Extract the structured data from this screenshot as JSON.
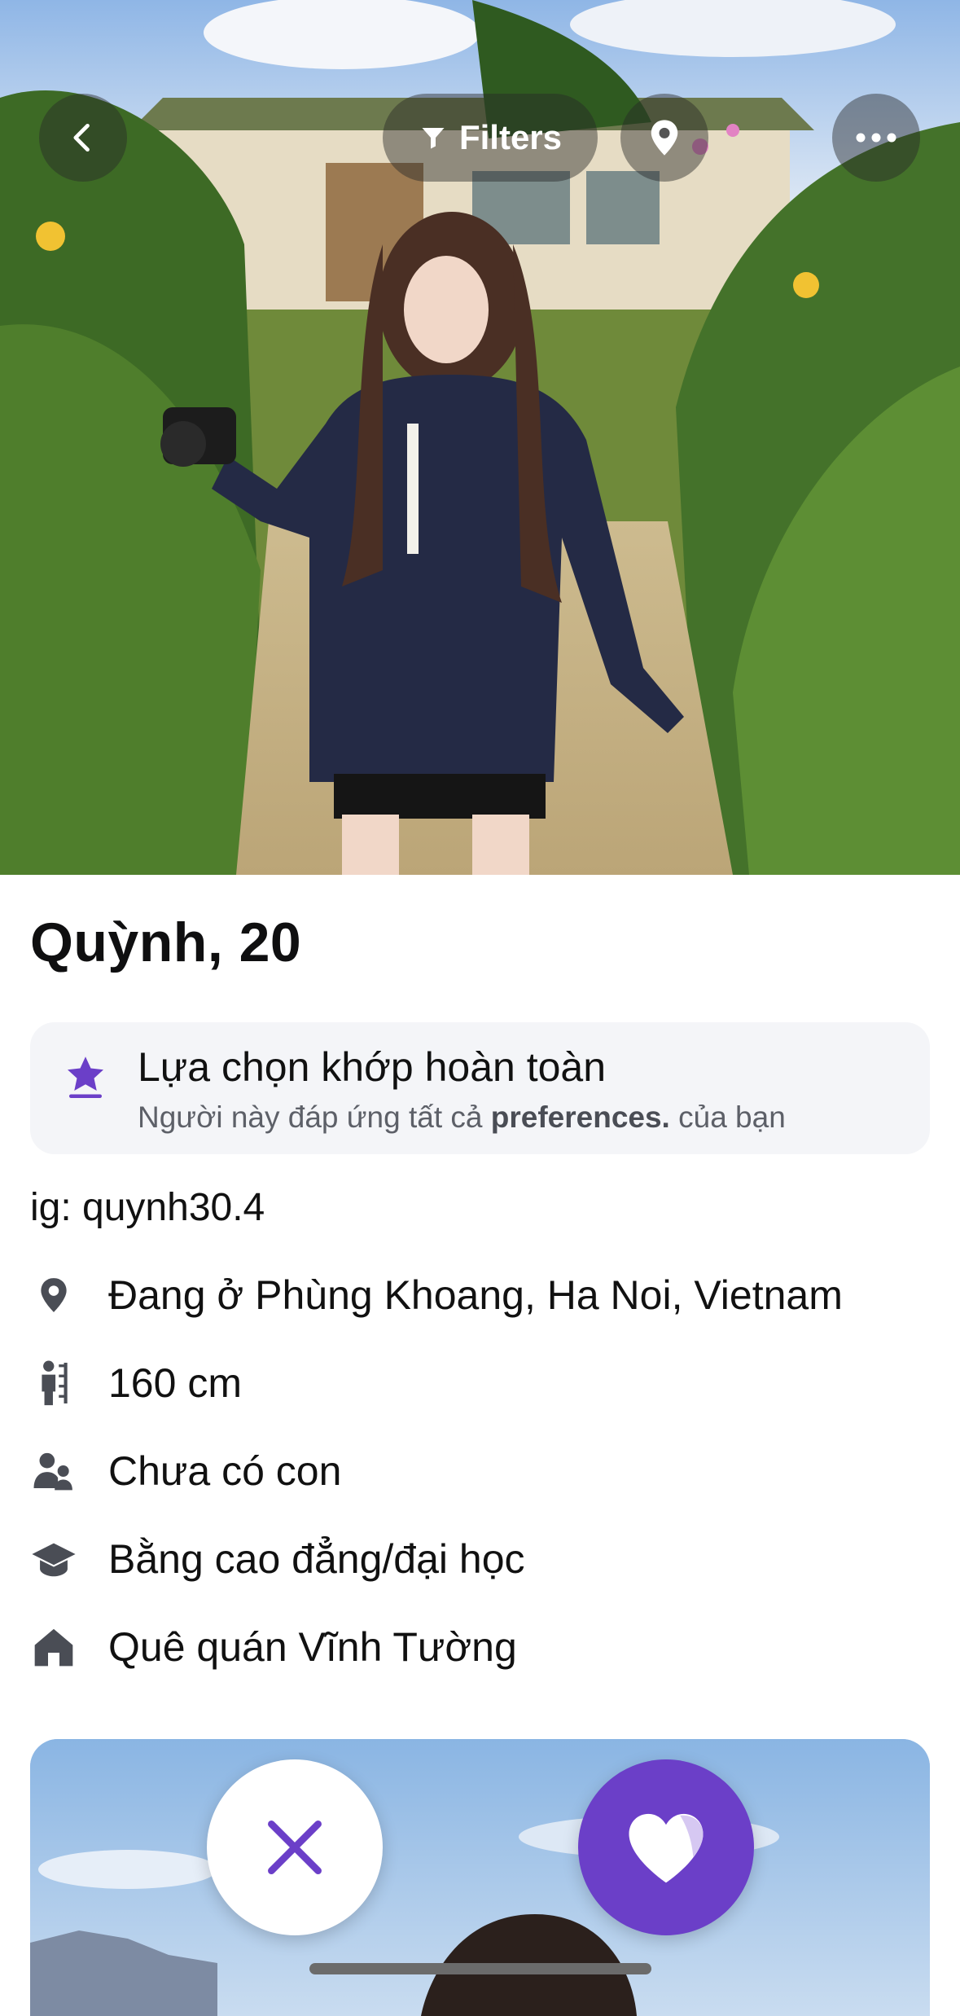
{
  "header": {
    "filters_label": "Filters",
    "icons": [
      "chevron-left-icon",
      "filter-icon",
      "location-pin-icon",
      "more-icon"
    ]
  },
  "profile": {
    "name_age": "Quỳnh, 20",
    "match": {
      "title": "Lựa chọn khớp hoàn toàn",
      "subtitle_prefix": "Người này đáp ứng tất cả ",
      "subtitle_bold": "preferences.",
      "subtitle_suffix": " của bạn"
    },
    "bio": "ig: quynh30.4",
    "details": [
      {
        "icon": "location-pin-icon",
        "text": "Đang ở Phùng Khoang, Ha Noi, Vietnam"
      },
      {
        "icon": "height-icon",
        "text": "160 cm"
      },
      {
        "icon": "children-icon",
        "text": "Chưa có con"
      },
      {
        "icon": "graduation-cap-icon",
        "text": "Bằng cao đẳng/đại học"
      },
      {
        "icon": "home-icon",
        "text": "Quê quán Vĩnh Tường"
      }
    ]
  },
  "actions": {
    "pass_icon": "close-icon",
    "like_icon": "heart-icon"
  },
  "colors": {
    "accent": "#6b3fc8",
    "icon_gray": "#4a4d55",
    "card_bg": "#f4f5f8"
  }
}
